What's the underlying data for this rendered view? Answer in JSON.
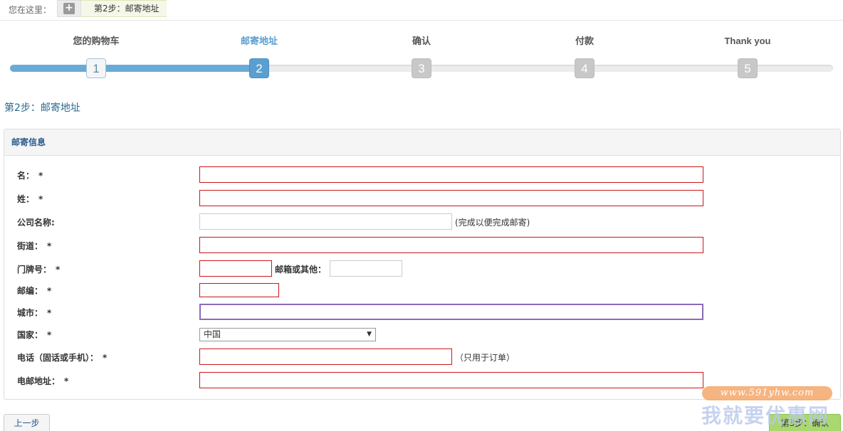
{
  "breadcrumb": {
    "label": "您在这里：",
    "current": "第2步：邮寄地址"
  },
  "steps": [
    {
      "label": "您的购物车",
      "num": "1",
      "state": "done"
    },
    {
      "label": "邮寄地址",
      "num": "2",
      "state": "active"
    },
    {
      "label": "确认",
      "num": "3",
      "state": "pending"
    },
    {
      "label": "付款",
      "num": "4",
      "state": "pending"
    },
    {
      "label": "Thank you",
      "num": "5",
      "state": "pending"
    }
  ],
  "progress_fraction": 0.3,
  "page_title": "第2步：邮寄地址",
  "panel": {
    "title": "邮寄信息"
  },
  "form": {
    "first_name": {
      "label": "名：",
      "required": "*",
      "value": ""
    },
    "last_name": {
      "label": "姓：",
      "required": "*",
      "value": ""
    },
    "company": {
      "label": "公司名称:",
      "value": "",
      "hint": "(完成以便完成邮寄)"
    },
    "street": {
      "label": "街道：",
      "required": "*",
      "value": ""
    },
    "house_number": {
      "label": "门牌号：",
      "required": "*",
      "value": ""
    },
    "po_box": {
      "label": "邮箱或其他：",
      "value": ""
    },
    "zip": {
      "label": "邮编：",
      "required": "*",
      "value": ""
    },
    "city": {
      "label": "城市：",
      "required": "*",
      "value": ""
    },
    "country": {
      "label": "国家：",
      "required": "*",
      "value": "中国"
    },
    "phone": {
      "label": "电话（固话或手机）：",
      "required": "*",
      "value": "",
      "hint": "（只用于订单）"
    },
    "email": {
      "label": "电邮地址：",
      "required": "*",
      "value": ""
    }
  },
  "buttons": {
    "back": "上一步",
    "next": "第3步：确认"
  },
  "watermark": {
    "url": "www.591yhw.com",
    "text": "我就要优惠网"
  },
  "colors": {
    "progress": "#6aaad6",
    "required_border": "#c9171b",
    "next_button": "#a9d86e"
  }
}
